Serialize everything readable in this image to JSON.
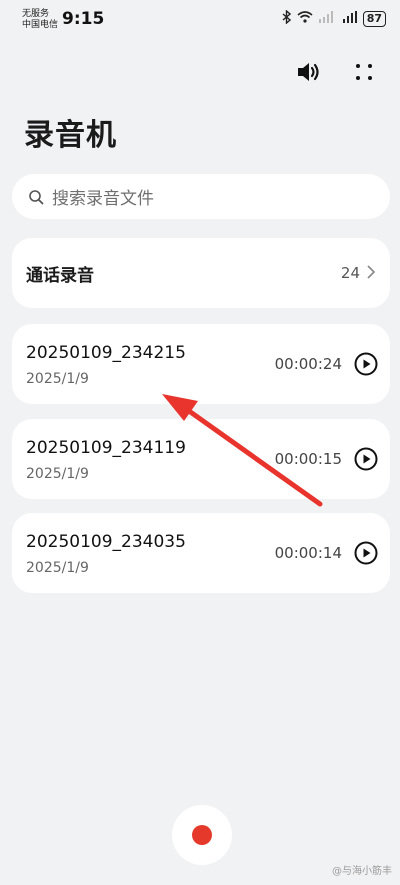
{
  "status_bar": {
    "carrier_line1": "无服务",
    "carrier_line2": "中国电信",
    "time": "9:15",
    "battery": "87"
  },
  "icons": {
    "speaker": "speaker-icon",
    "more": "more-icon",
    "search": "search-icon",
    "chevron": "chevron-right-icon",
    "play": "play-icon",
    "record": "record-icon"
  },
  "page": {
    "title": "录音机"
  },
  "search": {
    "placeholder": "搜索录音文件"
  },
  "call_recordings": {
    "label": "通话录音",
    "count": "24"
  },
  "recordings": [
    {
      "name": "20250109_234215",
      "date": "2025/1/9",
      "duration": "00:00:24"
    },
    {
      "name": "20250109_234119",
      "date": "2025/1/9",
      "duration": "00:00:15"
    },
    {
      "name": "20250109_234035",
      "date": "2025/1/9",
      "duration": "00:00:14"
    }
  ],
  "colors": {
    "record": "#e53a2b",
    "arrow": "#e8342c",
    "background": "#f1f2f4"
  },
  "watermark": "@与海小筋丰"
}
